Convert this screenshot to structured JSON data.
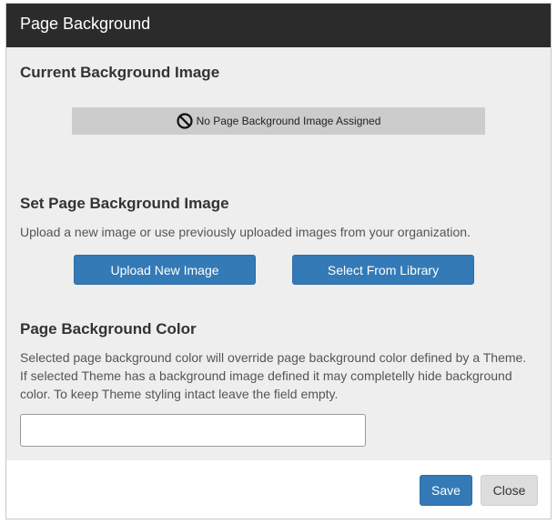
{
  "dialog": {
    "title": "Page Background"
  },
  "current_image": {
    "heading": "Current Background Image",
    "status_text": "No Page Background Image Assigned",
    "status_icon": "prohibited-icon"
  },
  "set_image": {
    "heading": "Set Page Background Image",
    "description": "Upload a new image or use previously uploaded images from your organization.",
    "upload_label": "Upload New Image",
    "library_label": "Select From Library"
  },
  "bg_color": {
    "heading": "Page Background Color",
    "description_line1": "Selected page background color will override page background color defined by a Theme.",
    "description_line2": "If selected Theme has a background image defined it may completelly hide background",
    "description_line3": "color. To keep Theme styling intact leave the field empty.",
    "value": ""
  },
  "footer": {
    "save_label": "Save",
    "close_label": "Close"
  },
  "colors": {
    "titlebar": "#2b2b2b",
    "body": "#eeeeee",
    "primary": "#337ab7",
    "secondary": "#dddddd"
  }
}
